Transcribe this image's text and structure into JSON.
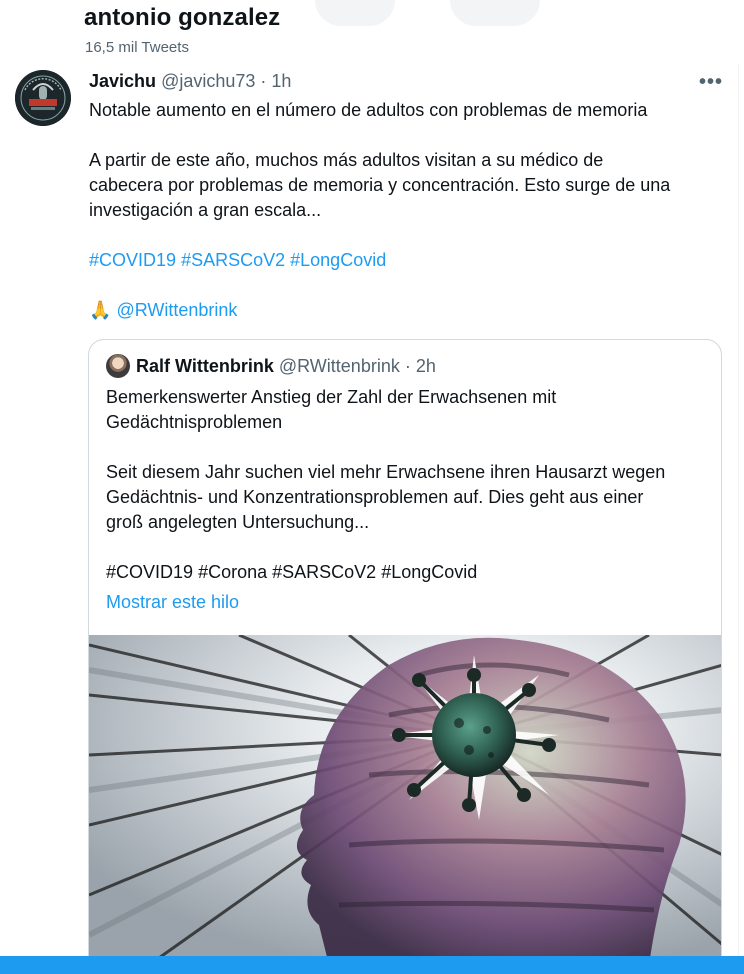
{
  "profile_header": {
    "name": "antonio gonzalez",
    "tweet_count": "16,5 mil Tweets"
  },
  "tweet": {
    "author_name": "Javichu",
    "author_handle": "@javichu73",
    "separator": "·",
    "time": "1h",
    "more_label": "•••",
    "line1": "Notable aumento en el número de adultos con problemas de memoria",
    "line2": "A partir de este año, muchos más adultos visitan a su médico de",
    "line3": "cabecera por problemas de memoria y concentración. Esto surge de una",
    "line4": "investigación a gran escala...",
    "hashtags": [
      "#COVID19",
      "#SARSCoV2",
      "#LongCovid"
    ],
    "emoji": "🙏",
    "mention": "@RWittenbrink",
    "avatar_text_top": "LONG COVID",
    "avatar_text_mid": "EL RESPETO"
  },
  "quote": {
    "author_name": "Ralf Wittenbrink",
    "author_handle": "@RWittenbrink",
    "separator": "·",
    "time": "2h",
    "line1": "Bemerkenswerter Anstieg der Zahl der Erwachsenen mit",
    "line2": "Gedächtnisproblemen",
    "line3": "Seit diesem Jahr suchen viel mehr Erwachsene ihren Hausarzt wegen",
    "line4": "Gedächtnis- und Konzentrationsproblemen auf. Dies geht aus einer",
    "line5": "groß angelegten Untersuchung...",
    "hashtags": [
      "#COVID19",
      "#Corona",
      "#SARSCoV2",
      "#LongCovid"
    ],
    "show_thread": "Mostrar este hilo"
  },
  "colors": {
    "accent": "#1d9bf0",
    "text": "#0f1419",
    "muted": "#536471",
    "border": "#cfd9de"
  }
}
